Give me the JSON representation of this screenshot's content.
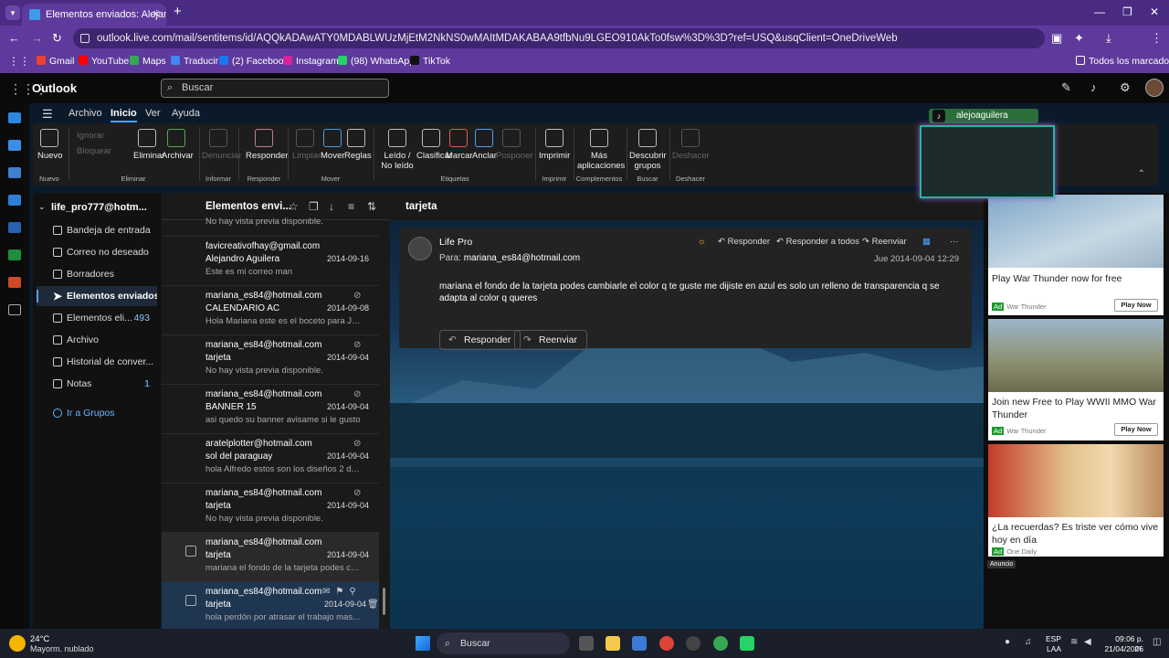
{
  "browser": {
    "tab_title": "Elementos enviados: Alejandro",
    "url": "outlook.live.com/mail/sentitems/id/AQQkADAwATY0MDABLWUzMjEtM2NkNS0wMAItMDAKABAA9tfbNu9LGEO910AkTo0fsw%3D%3D?ref=USQ&usqClient=OneDriveWeb",
    "bookmarks": [
      "Gmail",
      "YouTube",
      "Maps",
      "Traducir",
      "(2) Facebook",
      "Instagram",
      "(98) WhatsApp",
      "TikTok"
    ],
    "all_bookmarks": "Todos los marcadores"
  },
  "outlook": {
    "brand": "Outlook",
    "search_placeholder": "Buscar",
    "menu_tabs": [
      "Archivo",
      "Inicio",
      "Ver",
      "Ayuda"
    ],
    "ribbon": {
      "nuevo": "Nuevo",
      "ignorar": "Ignorar",
      "bloquear": "Bloquear",
      "eliminar": "Eliminar",
      "archivar": "Archivar",
      "denunciar": "Denunciar",
      "responder": "Responder",
      "limpiar": "Limpiar",
      "mover": "Mover",
      "reglas": "Reglas",
      "leido": "Leído / No leído",
      "clasificar": "Clasificar",
      "marcar": "Marcar",
      "anclar": "Anclar",
      "posponer": "Posponer",
      "imprimir": "Imprimir",
      "mas_apps": "Más aplicaciones",
      "descubrir": "Descubrir grupos",
      "deshacer": "Deshacer",
      "groups": [
        "Nuevo",
        "Eliminar",
        "Informar",
        "Responder",
        "Mover",
        "Etiquetas",
        "Imprimir",
        "Complementos",
        "Buscar",
        "Deshacer"
      ]
    },
    "account": "life_pro777@hotm...",
    "folders": [
      {
        "label": "Bandeja de entrada",
        "count": ""
      },
      {
        "label": "Correo no deseado",
        "count": ""
      },
      {
        "label": "Borradores",
        "count": ""
      },
      {
        "label": "Elementos enviados",
        "count": ""
      },
      {
        "label": "Elementos eli...",
        "count": "493"
      },
      {
        "label": "Archivo",
        "count": ""
      },
      {
        "label": "Historial de conver...",
        "count": ""
      },
      {
        "label": "Notas",
        "count": "1"
      },
      {
        "label": "Ir a Grupos",
        "count": ""
      }
    ],
    "list_title": "Elementos envi...",
    "partial_preview": "No hay vista previa disponible.",
    "messages": [
      {
        "sender": "favicreativofhay@gmail.com",
        "subject": "Alejandro Aguilera",
        "date": "2014-09-16",
        "preview": "Este es mi correo man"
      },
      {
        "sender": "mariana_es84@hotmail.com",
        "subject": "CALENDARIO AC",
        "date": "2014-09-08",
        "preview": "Hola Mariana este es el boceto para Juli..."
      },
      {
        "sender": "mariana_es84@hotmail.com",
        "subject": "tarjeta",
        "date": "2014-09-04",
        "preview": "No hay vista previa disponible."
      },
      {
        "sender": "mariana_es84@hotmail.com",
        "subject": "BANNER 15",
        "date": "2014-09-04",
        "preview": "asi quedo su banner avisame si le gusto"
      },
      {
        "sender": "aratelplotter@hotmail.com",
        "subject": "sol del paraguay",
        "date": "2014-09-04",
        "preview": "hola Alfredo estos son los diseños 2 de ..."
      },
      {
        "sender": "mariana_es84@hotmail.com",
        "subject": "tarjeta",
        "date": "2014-09-04",
        "preview": "No hay vista previa disponible."
      },
      {
        "sender": "mariana_es84@hotmail.com",
        "subject": "tarjeta",
        "date": "2014-09-04",
        "preview": "mariana el fondo de la tarjeta podes ca..."
      },
      {
        "sender": "mariana_es84@hotmail.com",
        "subject": "tarjeta",
        "date": "2014-09-04",
        "preview": "hola perdón por atrasar el trabajo mas t..."
      }
    ],
    "reading": {
      "subject": "tarjeta",
      "from": "Life Pro",
      "to_label": "Para:",
      "to": "mariana_es84@hotmail.com",
      "date": "Jue 2014-09-04 12:29",
      "responder": "Responder",
      "responder_todos": "Responder a todos",
      "reenviar": "Reenviar",
      "body": "mariana el fondo de la tarjeta podes cambiarle el color  q te guste me dijiste en azul es solo un relleno de transparencia q se adapta al color q queres",
      "btn_responder": "Responder",
      "btn_reenviar": "Reenviar"
    }
  },
  "ads": [
    {
      "caption": "Play War Thunder now for free",
      "source": "War Thunder",
      "cta": "Play Now"
    },
    {
      "caption": "Join new Free to Play WWII MMO War Thunder",
      "source": "War Thunder",
      "cta": "Play Now"
    },
    {
      "caption": "¿La recuerdas? Es triste ver cómo vive hoy en día",
      "source": "One Daily",
      "cta": ""
    }
  ],
  "ad_badge": "Ad",
  "anuncio": "Anuncio",
  "webcam_tag": "alejoaguilera",
  "taskbar": {
    "temp": "24°C",
    "weather": "Mayorm. nublado",
    "search": "Buscar",
    "lang1": "ESP",
    "lang2": "LAA",
    "time": "09:06 p. m.",
    "date": "21/04/2026"
  },
  "colors": {
    "accent": "#4aa3ff",
    "browser_purple": "#5e3a9c"
  }
}
